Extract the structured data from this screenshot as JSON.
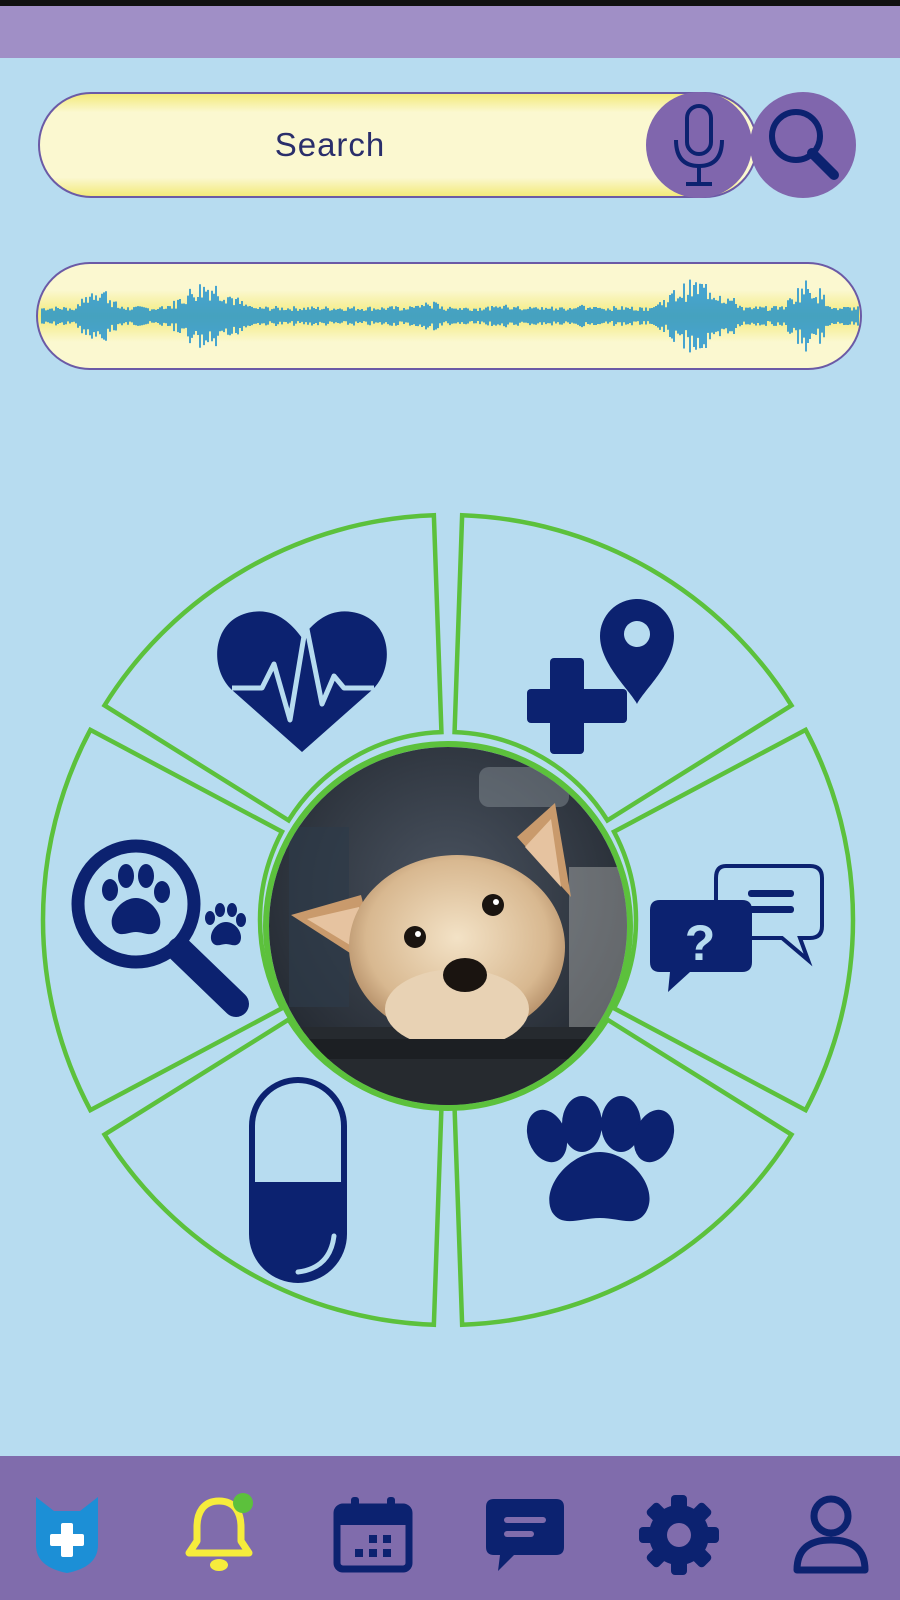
{
  "search": {
    "label": "Search",
    "mic_icon": "microphone-icon",
    "search_icon": "magnifier-icon"
  },
  "voice_waveform": {
    "icon": "audio-waveform-icon"
  },
  "wheel": {
    "center_image": "dog-photo",
    "segments": [
      {
        "id": "health",
        "icon": "heart-pulse-icon"
      },
      {
        "id": "vet-locator",
        "icon": "medical-location-icon"
      },
      {
        "id": "questions",
        "icon": "chat-question-icon"
      },
      {
        "id": "pets",
        "icon": "paw-icon"
      },
      {
        "id": "medication",
        "icon": "pill-icon"
      },
      {
        "id": "pet-search",
        "icon": "paw-magnifier-icon"
      }
    ]
  },
  "bottom_nav": {
    "items": [
      {
        "id": "home",
        "icon": "cat-medical-icon"
      },
      {
        "id": "notifications",
        "icon": "bell-icon",
        "badge": true
      },
      {
        "id": "calendar",
        "icon": "calendar-icon"
      },
      {
        "id": "messages",
        "icon": "message-icon"
      },
      {
        "id": "settings",
        "icon": "gear-icon"
      },
      {
        "id": "profile",
        "icon": "user-icon"
      }
    ]
  },
  "colors": {
    "background": "#b7dcf0",
    "bar_purple": "#806cac",
    "accent_green": "#5cc13c",
    "icon_navy": "#0c2270",
    "pill_yellow": "#f3ea7a"
  }
}
